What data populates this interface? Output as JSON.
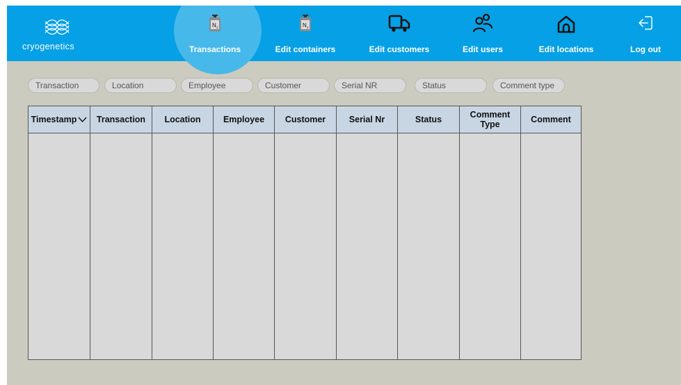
{
  "app": {
    "logo_text": "cryogenetics"
  },
  "colors": {
    "topbar": "#06a0e6",
    "active_highlight": "#46b8ea",
    "page_background": "#cccbbf",
    "table_header": "#c8d6e4",
    "table_body": "#d9d9d9"
  },
  "nav": {
    "items": [
      {
        "label": "Transactions",
        "icon": "nitrogen-container-icon",
        "active": true
      },
      {
        "label": "Edit containers",
        "icon": "nitrogen-container-icon",
        "active": false
      },
      {
        "label": "Edit customers",
        "icon": "truck-icon",
        "active": false
      },
      {
        "label": "Edit users",
        "icon": "users-icon",
        "active": false
      },
      {
        "label": "Edit locations",
        "icon": "home-icon",
        "active": false
      },
      {
        "label": "Log out",
        "icon": "logout-icon",
        "active": false
      }
    ],
    "container_icon_text": "N",
    "container_icon_sub": "2"
  },
  "filters": [
    "Transaction",
    "Location",
    "Employee",
    "Customer",
    "Serial NR",
    "Status",
    "Comment type"
  ],
  "table": {
    "columns": [
      "Timestamp",
      "Transaction",
      "Location",
      "Employee",
      "Customer",
      "Serial Nr",
      "Status",
      "Comment Type",
      "Comment"
    ],
    "sort_column": "Timestamp",
    "sort_direction": "descending",
    "rows": []
  }
}
